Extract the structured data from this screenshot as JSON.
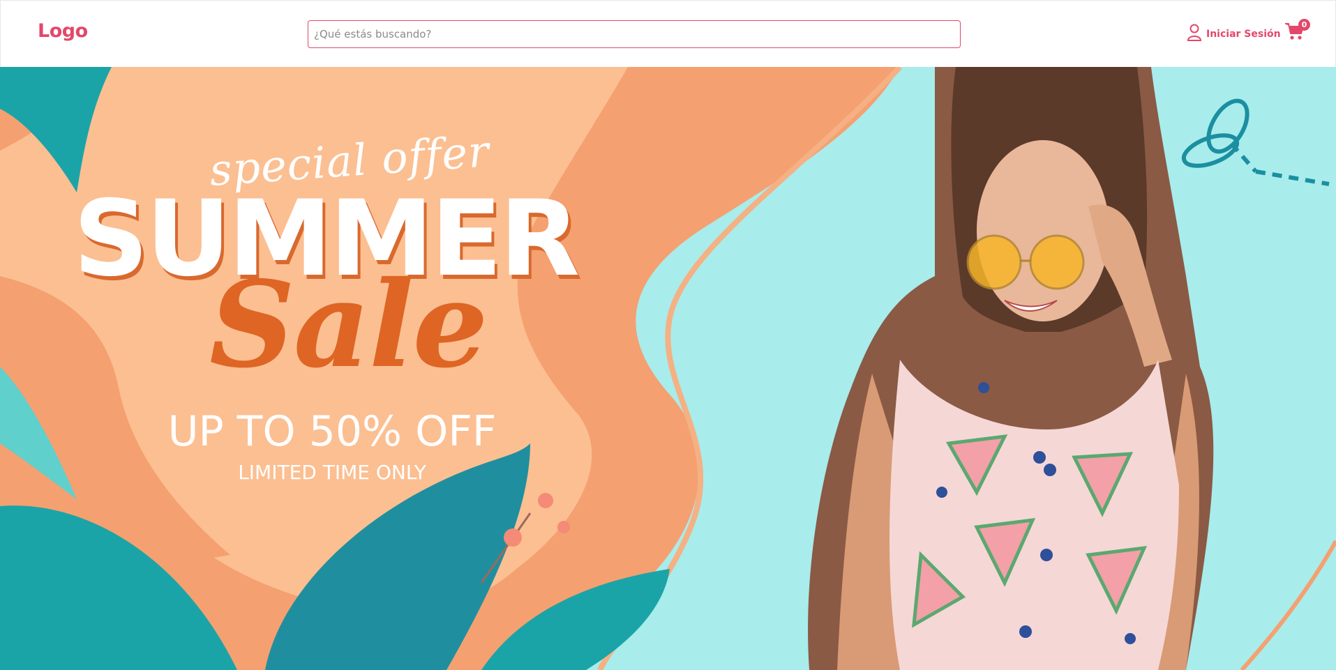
{
  "header": {
    "logo": "Logo",
    "search_placeholder": "¿Qué estás buscando?",
    "login_label": "Iniciar Sesión",
    "cart_count": "0",
    "icons": {
      "user": "user-icon",
      "cart": "cart-icon"
    }
  },
  "hero": {
    "special_offer": "special offer",
    "headline": "SUMMER",
    "sale": "Sale",
    "discount": "UP TO 50% OFF",
    "subline": "LIMITED TIME ONLY"
  },
  "colors": {
    "brand": "#e3486a",
    "hero_orange": "#f5a070",
    "hero_peach": "#fbbf92",
    "hero_teal": "#8fe3e3",
    "leaf_teal": "#1aa3a6",
    "sale_orange": "#de6524"
  }
}
